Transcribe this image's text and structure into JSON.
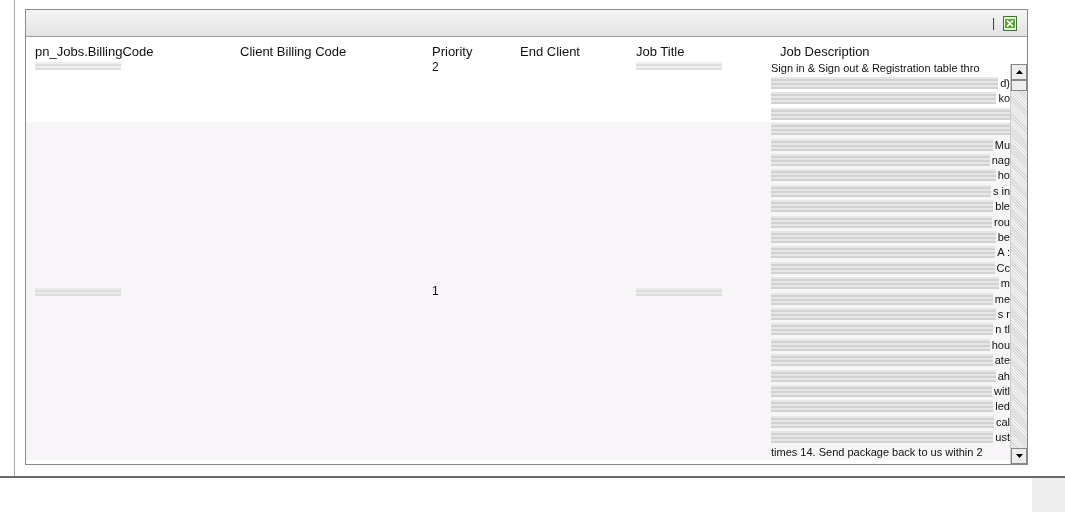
{
  "toolbar": {
    "separator": "|"
  },
  "table": {
    "columns": [
      "pn_Jobs.BillingCode",
      "Client Billing Code",
      "Priority",
      "End Client",
      "Job Title",
      "Job Description"
    ],
    "rows": [
      {
        "billing_code_redacted": true,
        "priority": "2",
        "job_title_redacted": true,
        "description_lines": [
          {
            "text": "Sign in & Sign out & Registration table thro",
            "redacted": false
          },
          {
            "text": "d)",
            "redacted": true
          },
          {
            "text": "ko",
            "redacted": true
          },
          {
            "redacted": true
          }
        ]
      },
      {
        "billing_code_redacted": true,
        "priority": "1",
        "job_title_redacted": true,
        "description_lines": [
          {
            "redacted": true
          },
          {
            "text": "Mu",
            "redacted": true
          },
          {
            "text": "nag",
            "redacted": true
          },
          {
            "text": "ho",
            "redacted": true
          },
          {
            "text": "s in",
            "redacted": true
          },
          {
            "text": "ble",
            "redacted": true
          },
          {
            "text": "rou",
            "redacted": true
          },
          {
            "text": "be",
            "redacted": true
          },
          {
            "text": "A :",
            "redacted": true
          },
          {
            "text": "Cc",
            "redacted": true
          },
          {
            "text": "m",
            "redacted": true
          },
          {
            "text": "me",
            "redacted": true
          },
          {
            "text": "s r",
            "redacted": true
          },
          {
            "text": "n tl",
            "redacted": true
          },
          {
            "text": "hou",
            "redacted": true
          },
          {
            "text": "ate",
            "redacted": true
          },
          {
            "text": "ah",
            "redacted": true
          },
          {
            "text": "witl",
            "redacted": true
          },
          {
            "text": "led",
            "redacted": true
          },
          {
            "text": "cal",
            "redacted": true
          },
          {
            "text": "ust",
            "redacted": true
          },
          {
            "text": "times 14. Send package back to us within 2",
            "redacted": false
          }
        ]
      }
    ]
  }
}
